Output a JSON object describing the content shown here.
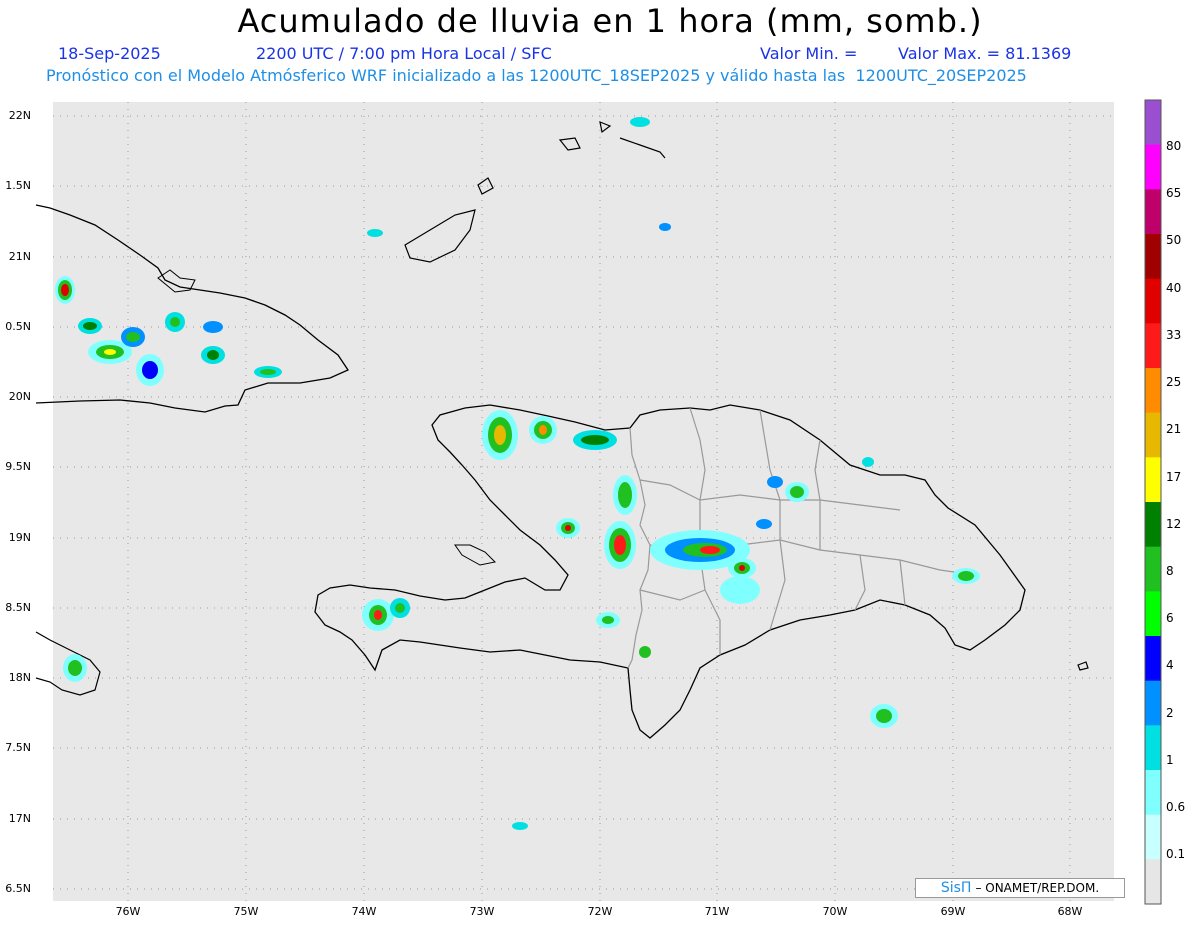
{
  "title": "Acumulado de lluvia en 1 hora (mm, somb.)",
  "date": "18-Sep-2025",
  "time": "2200 UTC / 7:00 pm Hora Local / SFC",
  "min_label": "Valor Min. =",
  "max_label": "Valor Max. = 81.1369",
  "forecast_line": "Pronóstico con el Modelo Atmósferico WRF inicializado a las 1200UTC_18SEP2025 y válido hasta las  1200UTC_20SEP2025",
  "y_ticks": [
    "22N",
    "1.5N",
    "21N",
    "0.5N",
    "20N",
    "9.5N",
    "19N",
    "8.5N",
    "18N",
    "7.5N",
    "17N",
    "6.5N"
  ],
  "x_ticks": [
    "76W",
    "75W",
    "74W",
    "73W",
    "72W",
    "71W",
    "70W",
    "69W",
    "68W"
  ],
  "colorbar": {
    "labels": [
      "80",
      "65",
      "50",
      "40",
      "33",
      "25",
      "21",
      "17",
      "12",
      "8",
      "6",
      "4",
      "2",
      "1",
      "0.6",
      "0.1"
    ],
    "colors": [
      "#9a4fd0",
      "#ff00ff",
      "#c0006a",
      "#a00000",
      "#e00000",
      "#ff1a1a",
      "#ff8c00",
      "#e6b800",
      "#ffff00",
      "#008000",
      "#20c020",
      "#00ff00",
      "#0000ff",
      "#0090ff",
      "#00e0e0",
      "#80ffff",
      "#c8ffff",
      "#e6e6e6"
    ]
  },
  "credit": {
    "brand": "SisΠ",
    "text": "– ONAMET/REP.DOM."
  },
  "map": {
    "background": "#e8e8e8",
    "coast_color": "#000000",
    "border_color": "#999999"
  }
}
